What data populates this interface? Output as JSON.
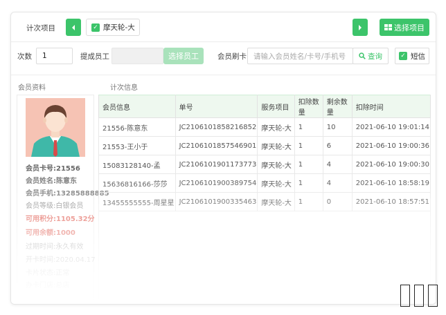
{
  "toolbar": {
    "count_item_label": "计次项目",
    "selected_item": "摩天轮-大",
    "select_item_button": "选择项目"
  },
  "form": {
    "times_label": "次数",
    "times_value": "1",
    "staff_label": "提成员工",
    "select_staff_button": "选择员工",
    "member_card_label": "会员刷卡",
    "member_card_placeholder": "请输入会员姓名/卡号/手机号",
    "query_button": "查询",
    "sms_label": "短信"
  },
  "sections": {
    "member_profile": "会员资料",
    "count_info": "计次信息"
  },
  "member": {
    "card_no": "会员卡号:21556",
    "name": "会员姓名:陈意东",
    "phone": "会员手机:13285888885",
    "level": "会员等级:白银会员",
    "points": "可用积分:1105.32分",
    "balance": "可用余额:1000",
    "expiry": "过期时间:永久有效",
    "open_date": "开卡时间:2020.04.17",
    "status": "卡片状态:正常",
    "extra": "办卡门店:总店"
  },
  "table": {
    "headers": [
      "会员信息",
      "单号",
      "服务项目",
      "扣除数量",
      "剩余数量",
      "扣除时间"
    ],
    "rows": [
      [
        "21556-陈意东",
        "JC2106101858216852",
        "摩天轮-大",
        "1",
        "10",
        "2021-06-10  19:01:14"
      ],
      [
        "21553-王小于",
        "JC2106101857546901",
        "摩天轮-大",
        "1",
        "6",
        "2021-06-10  19:00:36"
      ],
      [
        "15083128140-孟",
        "JC2106101901173773",
        "摩天轮-大",
        "1",
        "4",
        "2021-06-10  19:00:30"
      ],
      [
        "15636816166-莎莎",
        "JC2106101900389754",
        "摩天轮-大",
        "1",
        "4",
        "2021-06-10  18:58:19"
      ],
      [
        "13455555555-周星星",
        "JC2106101900335463",
        "摩天轮-大",
        "1",
        "0",
        "2021-06-10  18:57:51"
      ]
    ]
  },
  "colors": {
    "accent": "#3cc46a",
    "highlight_red": "#e05a4f",
    "header_bg": "#eef8ef"
  }
}
